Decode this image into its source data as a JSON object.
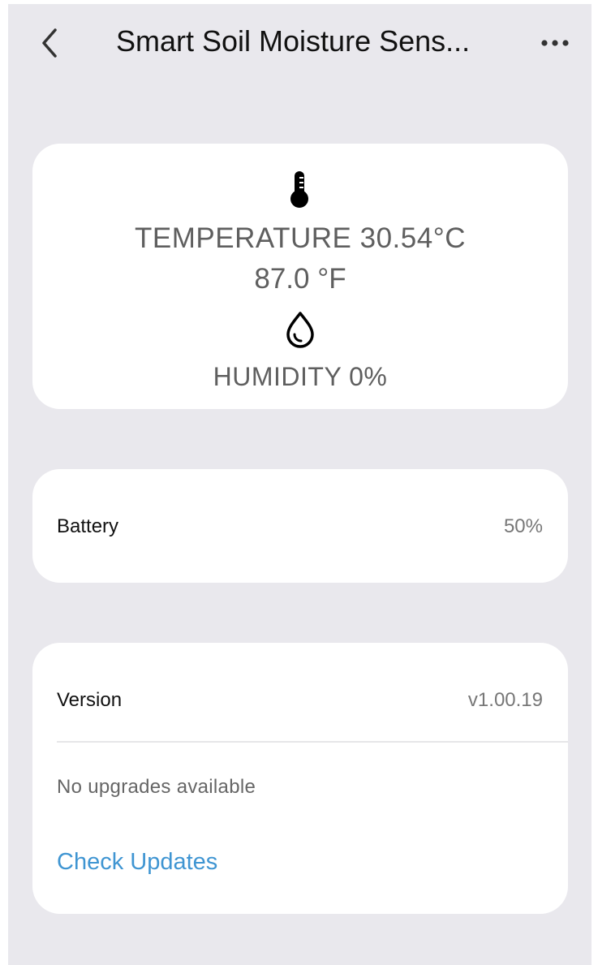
{
  "header": {
    "title": "Smart Soil Moisture Sens..."
  },
  "readings": {
    "temperature_label": "TEMPERATURE 30.54°C",
    "temperature_f": "87.0 °F",
    "humidity_label": "HUMIDITY 0%"
  },
  "battery": {
    "label": "Battery",
    "value": "50%"
  },
  "version": {
    "label": "Version",
    "value": "v1.00.19",
    "status": "No upgrades available",
    "check_label": "Check Updates"
  },
  "icons": {
    "back": "chevron-left-icon",
    "more": "more-horizontal-icon",
    "temperature": "thermometer-icon",
    "humidity": "water-drop-icon"
  },
  "colors": {
    "background": "#e9e8ed",
    "card": "#ffffff",
    "link": "#3f95d2",
    "reading_text": "#5f5f5f"
  }
}
